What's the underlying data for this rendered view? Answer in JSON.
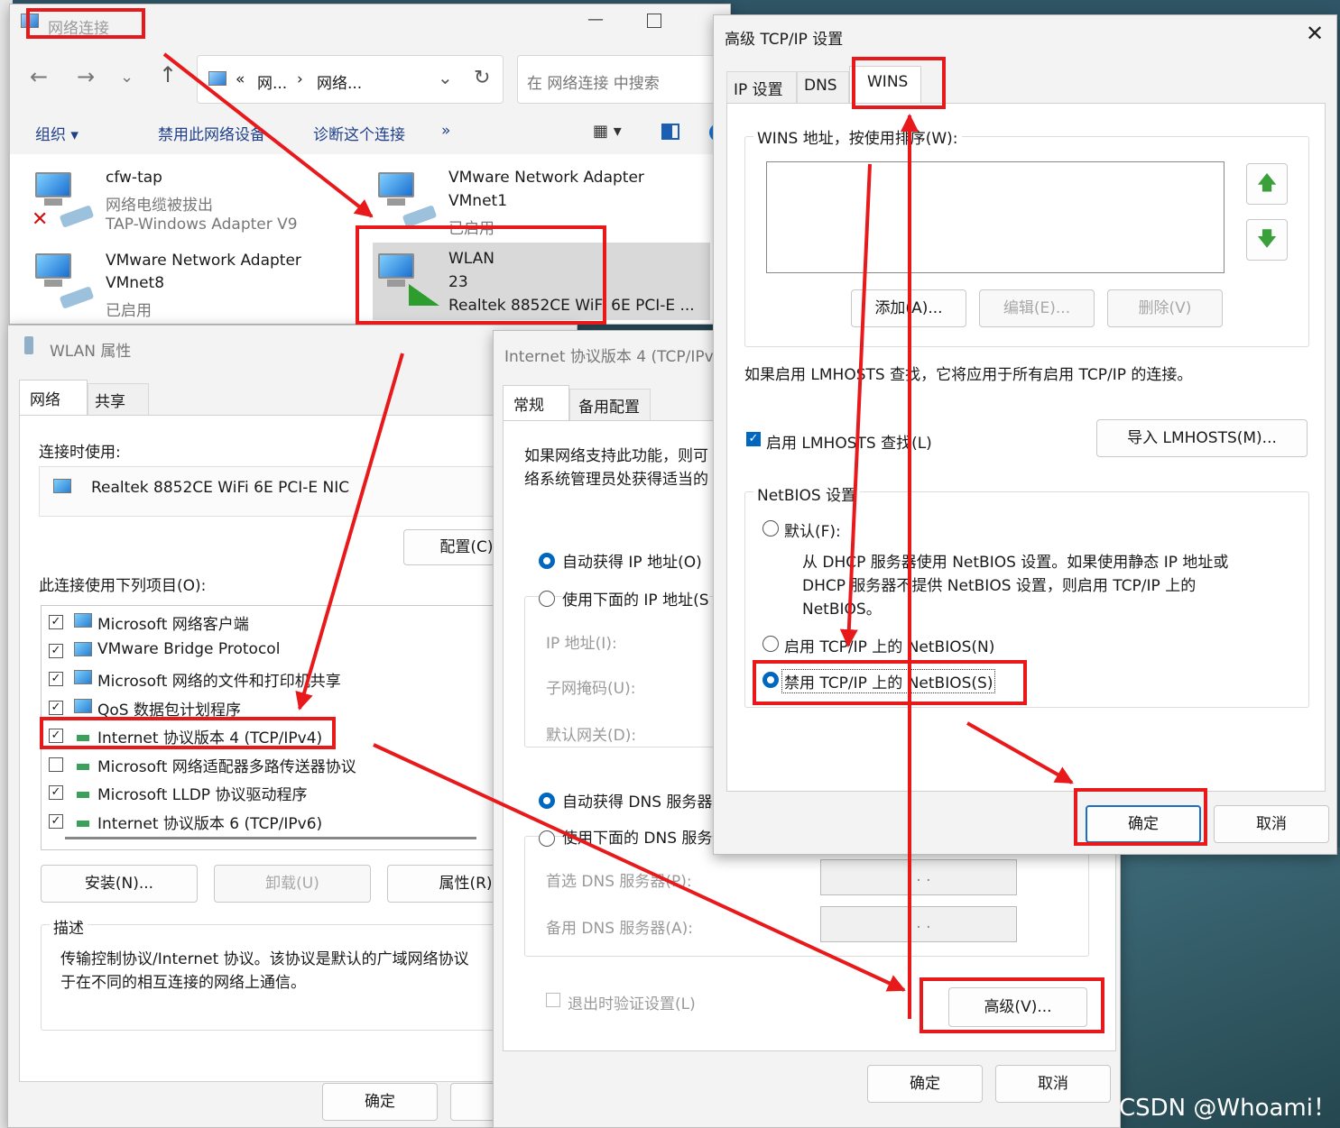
{
  "explorer": {
    "title": "网络连接",
    "breadcrumb": [
      "«",
      "网...",
      "›",
      "网络..."
    ],
    "search_placeholder": "在 网络连接 中搜索",
    "toolbar": {
      "organize": "组织 ▾",
      "disable": "禁用此网络设备",
      "diagnose": "诊断这个连接",
      "more": "»"
    },
    "adapters": [
      {
        "name": "cfw-tap",
        "line2": "网络电缆被拔出",
        "line3": "TAP-Windows Adapter V9"
      },
      {
        "name": "VMware Network Adapter",
        "line2": "VMnet1",
        "line3": "已启用"
      },
      {
        "name": "VMware Network Adapter",
        "line2": "VMnet8",
        "line3": "已启用"
      },
      {
        "name": "WLAN",
        "line2": "23",
        "line3": "Realtek 8852CE WiFi 6E PCI-E ..."
      }
    ]
  },
  "wlan_props": {
    "title": "WLAN 属性",
    "tabs": [
      "网络",
      "共享"
    ],
    "connect_using_label": "连接时使用:",
    "adapter_name": "Realtek 8852CE WiFi 6E PCI-E NIC",
    "configure": "配置(C)",
    "items_label": "此连接使用下列项目(O):",
    "items": [
      {
        "label": "Microsoft 网络客户端",
        "checked": true
      },
      {
        "label": "VMware Bridge Protocol",
        "checked": true
      },
      {
        "label": "Microsoft 网络的文件和打印机共享",
        "checked": true
      },
      {
        "label": "QoS 数据包计划程序",
        "checked": true
      },
      {
        "label": "Internet 协议版本 4 (TCP/IPv4)",
        "checked": true
      },
      {
        "label": "Microsoft 网络适配器多路传送器协议",
        "checked": false
      },
      {
        "label": "Microsoft LLDP 协议驱动程序",
        "checked": true
      },
      {
        "label": "Internet 协议版本 6 (TCP/IPv6)",
        "checked": true
      }
    ],
    "install": "安装(N)...",
    "uninstall": "卸载(U)",
    "properties": "属性(R)",
    "desc_label": "描述",
    "desc_text1": "传输控制协议/Internet 协议。该协议是默认的广域网络协议",
    "desc_text2": "于在不同的相互连接的网络上通信。",
    "ok": "确定"
  },
  "ipv4_props": {
    "title": "Internet 协议版本 4 (TCP/IPv4",
    "tabs": [
      "常规",
      "备用配置"
    ],
    "intro1": "如果网络支持此功能，则可",
    "intro2": "络系统管理员处获得适当的",
    "auto_ip": "自动获得 IP 地址(O)",
    "manual_ip": "使用下面的 IP 地址(S",
    "ip_addr": "IP 地址(I):",
    "subnet": "子网掩码(U):",
    "gateway": "默认网关(D):",
    "auto_dns": "自动获得 DNS 服务器",
    "manual_dns": "使用下面的 DNS 服务",
    "pref_dns": "首选 DNS 服务器(P):",
    "alt_dns": "备用 DNS 服务器(A):",
    "dots": ".    .    .",
    "validate": "退出时验证设置(L)",
    "advanced": "高级(V)...",
    "ok": "确定",
    "cancel": "取消"
  },
  "advanced": {
    "title": "高级 TCP/IP 设置",
    "tabs": [
      "IP 设置",
      "DNS",
      "WINS"
    ],
    "wins_label": "WINS 地址，按使用排序(W):",
    "add": "添加(A)...",
    "edit": "编辑(E)...",
    "remove": "删除(V)",
    "lmhosts_note": "如果启用 LMHOSTS 查找，它将应用于所有启用 TCP/IP 的连接。",
    "enable_lmhosts": "启用 LMHOSTS 查找(L)",
    "import_lmhosts": "导入 LMHOSTS(M)...",
    "netbios_label": "NetBIOS 设置",
    "default": "默认(F):",
    "default_desc1": "从 DHCP 服务器使用 NetBIOS 设置。如果使用静态 IP 地址或",
    "default_desc2": "DHCP 服务器不提供 NetBIOS 设置，则启用 TCP/IP 上的",
    "default_desc3": "NetBIOS。",
    "enable_netbios": "启用 TCP/IP 上的 NetBIOS(N)",
    "disable_netbios": "禁用 TCP/IP 上的 NetBIOS(S)",
    "ok": "确定",
    "cancel": "取消"
  },
  "watermark": "CSDN @Whoami！",
  "colors": {
    "highlight": "#e8191b",
    "accent": "#0067c0"
  }
}
